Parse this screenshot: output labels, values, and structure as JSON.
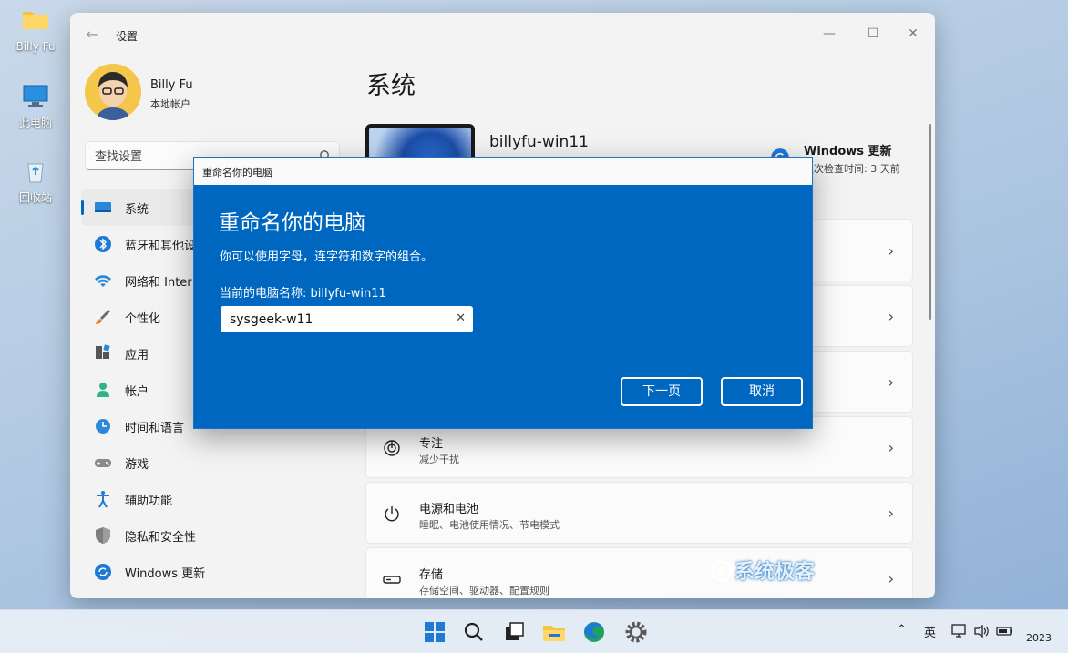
{
  "desktop": {
    "icons": [
      {
        "label": "Billy Fu"
      },
      {
        "label": "此电脑"
      },
      {
        "label": "回收站"
      }
    ]
  },
  "window": {
    "title": "设置",
    "user": {
      "name": "Billy Fu",
      "account_type": "本地帐户"
    },
    "search": {
      "placeholder": "查找设置"
    },
    "nav": [
      {
        "label": "系统",
        "icon": "monitor-icon",
        "active": true
      },
      {
        "label": "蓝牙和其他设",
        "icon": "bluetooth-icon"
      },
      {
        "label": "网络和 Inter",
        "icon": "wifi-icon"
      },
      {
        "label": "个性化",
        "icon": "brush-icon"
      },
      {
        "label": "应用",
        "icon": "apps-icon"
      },
      {
        "label": "帐户",
        "icon": "person-icon"
      },
      {
        "label": "时间和语言",
        "icon": "globe-clock-icon"
      },
      {
        "label": "游戏",
        "icon": "gamepad-icon"
      },
      {
        "label": "辅助功能",
        "icon": "accessibility-icon"
      },
      {
        "label": "隐私和安全性",
        "icon": "shield-icon"
      },
      {
        "label": "Windows 更新",
        "icon": "update-icon"
      }
    ],
    "page_title": "系统",
    "device_name": "billyfu-win11",
    "windows_update": {
      "title": "Windows 更新",
      "subtitle": "上次检查时间: 3 天前"
    },
    "cards": [
      {
        "title": "专注",
        "subtitle": "减少干扰",
        "icon": "focus-icon"
      },
      {
        "title": "电源和电池",
        "subtitle": "睡眠、电池使用情况、节电模式",
        "icon": "power-icon"
      },
      {
        "title": "存储",
        "subtitle": "存储空间、驱动器、配置规则",
        "icon": "storage-icon"
      }
    ],
    "watermark": "系统极客"
  },
  "dialog": {
    "window_title": "重命名你的电脑",
    "heading": "重命名你的电脑",
    "description": "你可以使用字母，连字符和数字的组合。",
    "current_name": "当前的电脑名称: billyfu-win11",
    "input_value": "sysgeek-w11",
    "next_label": "下一页",
    "cancel_label": "取消"
  },
  "taskbar": {
    "ime": "英",
    "clock": "2023",
    "colors": {
      "accent": "#0067c0"
    }
  }
}
